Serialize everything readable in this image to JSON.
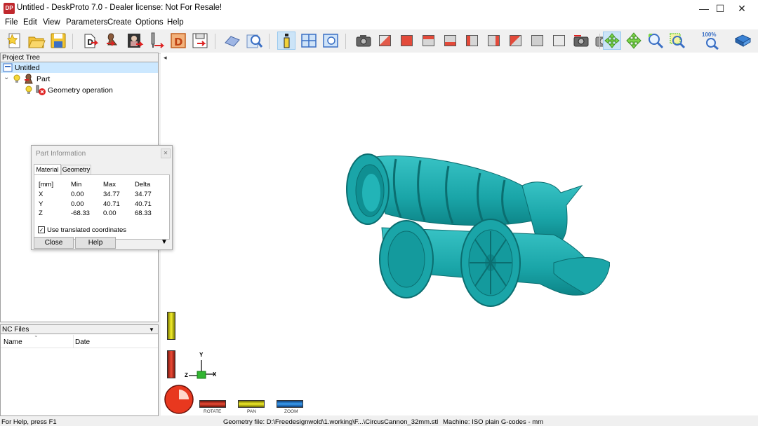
{
  "window": {
    "title": "Untitled - DeskProto 7.0 - Dealer license: Not For Resale!",
    "app_icon_text": "DP",
    "minimize_glyph": "—",
    "maximize_glyph": "☐",
    "close_glyph": "✕"
  },
  "menu": [
    "File",
    "Edit",
    "View",
    "Parameters",
    "Create",
    "Options",
    "Help"
  ],
  "toolbar": {
    "zoom_label": "100%"
  },
  "project_tree": {
    "header": "Project Tree",
    "root": "Untitled",
    "expander": "⌄",
    "part": "Part",
    "operation": "Geometry operation"
  },
  "nc_files": {
    "header": "NC Files",
    "col_name": "Name",
    "col_date": "Date",
    "dropdown_glyph": "▼",
    "sort_glyph": "⌄"
  },
  "part_info": {
    "title": "Part Information",
    "close_glyph": "✕",
    "tabs": [
      "Material",
      "Geometry"
    ],
    "headers": [
      "[mm]",
      "Min",
      "Max",
      "Delta"
    ],
    "rows": [
      {
        "axis": "X",
        "min": "0.00",
        "max": "34.77",
        "delta": "34.77"
      },
      {
        "axis": "Y",
        "min": "0.00",
        "max": "40.71",
        "delta": "40.71"
      },
      {
        "axis": "Z",
        "min": "-68.33",
        "max": "0.00",
        "delta": "68.33"
      }
    ],
    "checkbox_label": "Use translated coordinates",
    "checkbox_glyph": "✓",
    "close_button": "Close",
    "help_button": "Help",
    "more_glyph": "▼"
  },
  "viewport": {
    "collapse_glyph": "◂",
    "axis_labels": {
      "y": "Y",
      "z": "Z",
      "x": "X"
    },
    "model_color": "#1aa5a8",
    "mouse_modes": {
      "rotate": "ROTATE",
      "pan": "PAN",
      "zoom": "ZOOM"
    }
  },
  "status": {
    "help": "For Help, press F1",
    "geometry": "Geometry file: D:\\Freedesignwold\\1.working\\F...\\CircusCannon_32mm.stl",
    "machine": "Machine: ISO plain G-codes - mm"
  }
}
